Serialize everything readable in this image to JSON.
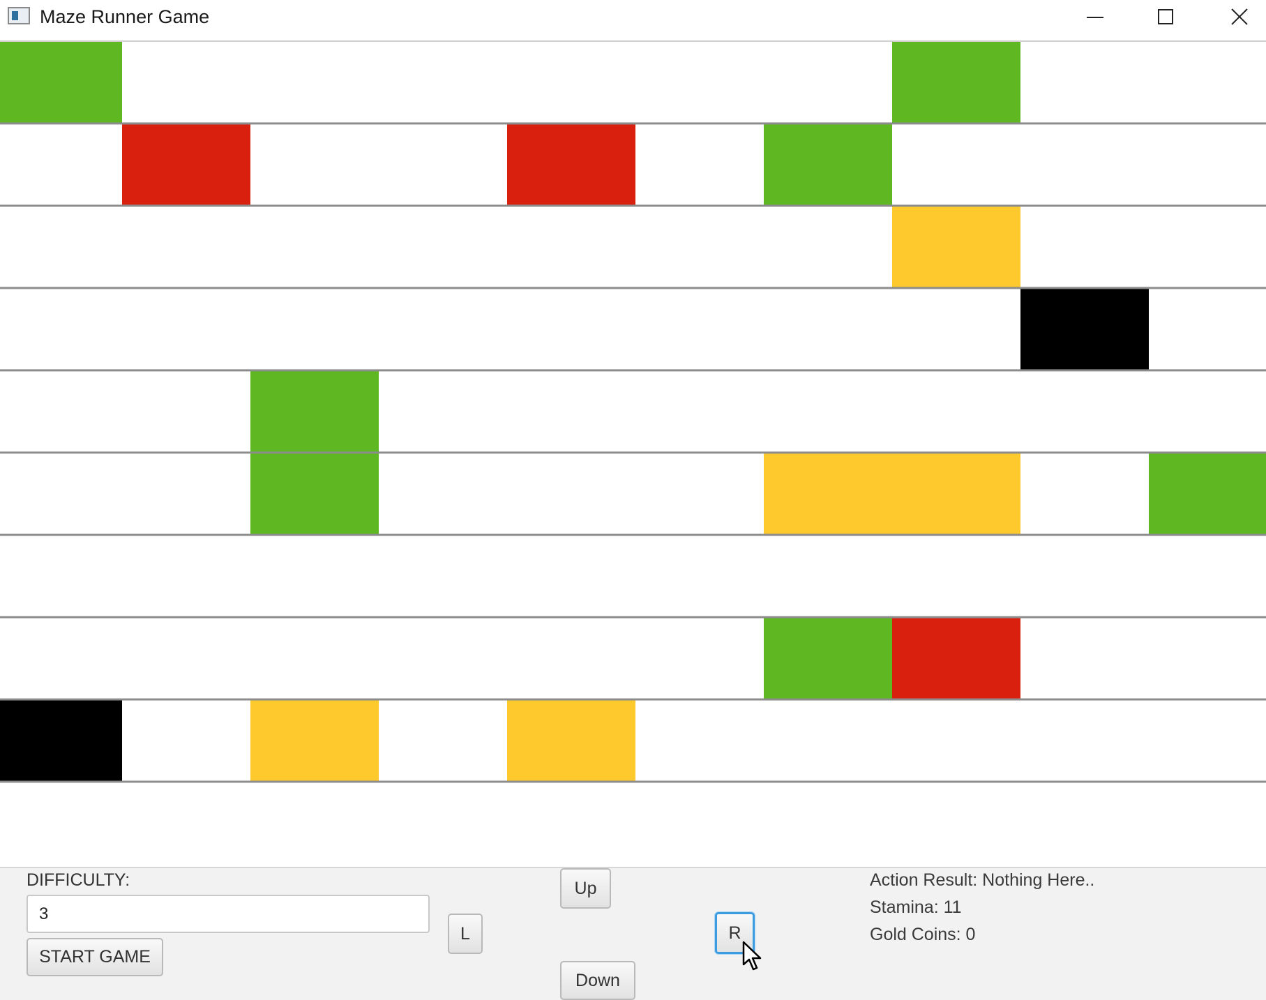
{
  "window": {
    "title": "Maze Runner Game",
    "icons": {
      "app": "app-window-icon",
      "minimize": "minimize-icon",
      "maximize": "maximize-icon",
      "close": "close-icon"
    }
  },
  "maze": {
    "rows": 10,
    "cols": 10,
    "colors": {
      "empty": "#ffffff",
      "green": "#5fb822",
      "red": "#d9200f",
      "yellow": "#fec92d",
      "black": "#000000",
      "grid_line": "#8c8c8c"
    },
    "cells": [
      [
        "green",
        "empty",
        "empty",
        "empty",
        "empty",
        "empty",
        "empty",
        "green",
        "empty",
        "empty"
      ],
      [
        "empty",
        "red",
        "empty",
        "empty",
        "red",
        "empty",
        "green",
        "empty",
        "empty",
        "empty"
      ],
      [
        "empty",
        "empty",
        "empty",
        "empty",
        "empty",
        "empty",
        "empty",
        "yellow",
        "empty",
        "empty"
      ],
      [
        "empty",
        "empty",
        "empty",
        "empty",
        "empty",
        "empty",
        "empty",
        "empty",
        "black",
        "empty"
      ],
      [
        "empty",
        "empty",
        "green",
        "empty",
        "empty",
        "empty",
        "empty",
        "empty",
        "empty",
        "empty"
      ],
      [
        "empty",
        "empty",
        "green",
        "empty",
        "empty",
        "empty",
        "yellow",
        "yellow",
        "empty",
        "green"
      ],
      [
        "empty",
        "empty",
        "empty",
        "empty",
        "empty",
        "empty",
        "empty",
        "empty",
        "empty",
        "empty"
      ],
      [
        "empty",
        "empty",
        "empty",
        "empty",
        "empty",
        "empty",
        "green",
        "red",
        "empty",
        "empty"
      ],
      [
        "black",
        "empty",
        "yellow",
        "empty",
        "yellow",
        "empty",
        "empty",
        "empty",
        "empty",
        "empty"
      ],
      [
        "empty",
        "empty",
        "empty",
        "empty",
        "empty",
        "empty",
        "empty",
        "empty",
        "empty",
        "empty"
      ]
    ]
  },
  "controls": {
    "difficulty_label": "DIFFICULTY:",
    "difficulty_value": "3",
    "start_label": "START GAME",
    "left_label": "L",
    "up_label": "Up",
    "right_label": "R",
    "down_label": "Down"
  },
  "status": {
    "action_result": "Action Result: Nothing Here..",
    "stamina": "Stamina: 11",
    "gold_coins": "Gold Coins: 0"
  }
}
